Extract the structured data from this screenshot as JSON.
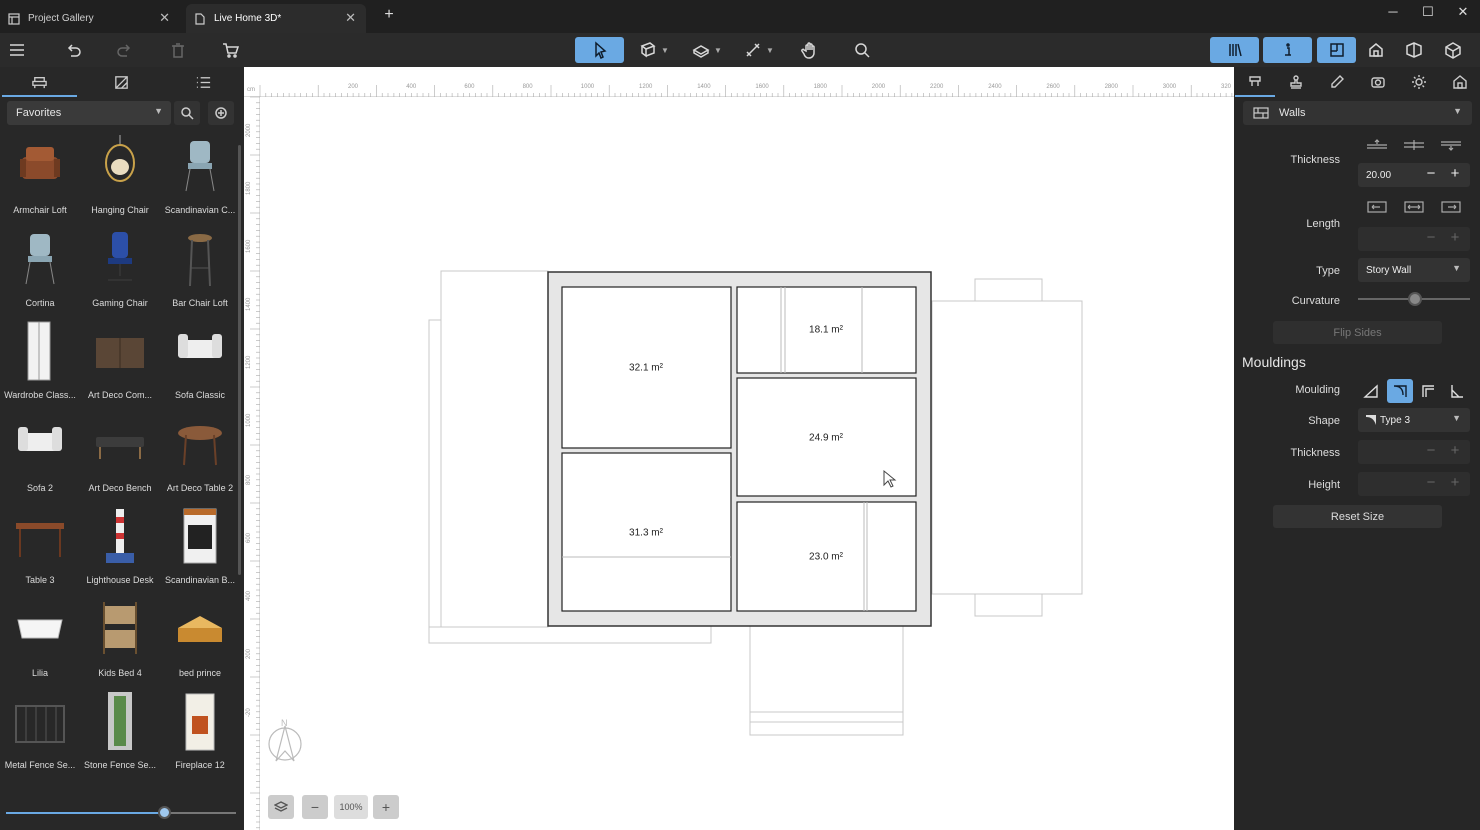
{
  "tabs": [
    {
      "label": "Project Gallery",
      "active": false
    },
    {
      "label": "Live Home 3D*",
      "active": true
    }
  ],
  "toolbar": {
    "icons": [
      "menu-icon",
      "undo-icon",
      "redo-icon",
      "delete-icon",
      "cart-icon",
      "select-arrow-icon",
      "build-tools-icon",
      "draw-tools-icon",
      "measure-icon",
      "pan-hand-icon",
      "search-icon"
    ],
    "right_icons": [
      "library-icon",
      "info-icon",
      "plan-2d-icon",
      "home-view-icon",
      "plan-3d-icon",
      "3d-view-icon"
    ]
  },
  "left_panel": {
    "tab_icons": [
      "furniture-icon",
      "materials-icon",
      "list-icon"
    ],
    "category": "Favorites",
    "items": [
      {
        "label": "Armchair Loft",
        "icon": "armchair-icon"
      },
      {
        "label": "Hanging Chair",
        "icon": "hanging-chair-icon"
      },
      {
        "label": "Scandinavian C...",
        "icon": "chair-icon"
      },
      {
        "label": "Cortina",
        "icon": "chair-icon"
      },
      {
        "label": "Gaming Chair",
        "icon": "gaming-chair-icon"
      },
      {
        "label": "Bar Chair Loft",
        "icon": "bar-stool-icon"
      },
      {
        "label": "Wardrobe Class...",
        "icon": "wardrobe-icon"
      },
      {
        "label": "Art Deco Com...",
        "icon": "commode-icon"
      },
      {
        "label": "Sofa Classic",
        "icon": "sofa-icon"
      },
      {
        "label": "Sofa 2",
        "icon": "sofa-icon"
      },
      {
        "label": "Art Deco Bench",
        "icon": "bench-icon"
      },
      {
        "label": "Art Deco Table 2",
        "icon": "table-icon"
      },
      {
        "label": "Table 3",
        "icon": "desk-icon"
      },
      {
        "label": "Lighthouse Desk",
        "icon": "lighthouse-icon"
      },
      {
        "label": "Scandinavian B...",
        "icon": "stove-icon"
      },
      {
        "label": "Lilia",
        "icon": "bathtub-icon"
      },
      {
        "label": "Kids Bed 4",
        "icon": "bunk-bed-icon"
      },
      {
        "label": "bed prince",
        "icon": "bed-icon"
      },
      {
        "label": "Metal Fence Se...",
        "icon": "fence-icon"
      },
      {
        "label": "Stone Fence Se...",
        "icon": "stone-fence-icon"
      },
      {
        "label": "Fireplace 12",
        "icon": "fireplace-icon"
      }
    ]
  },
  "canvas": {
    "ruler_unit": "cm",
    "top_ruler": [
      "200",
      "400",
      "600",
      "800",
      "1000",
      "1200",
      "1400",
      "1600",
      "1800",
      "2000",
      "2200",
      "2400",
      "2600",
      "2800",
      "3000",
      "320"
    ],
    "left_ruler": [
      "2000",
      "1800",
      "1600",
      "1400",
      "1200",
      "1000",
      "800",
      "600",
      "400",
      "200",
      "-20"
    ],
    "rooms": [
      "32.1 m²",
      "18.1 m²",
      "24.9 m²",
      "31.3 m²",
      "23.0 m²"
    ],
    "zoom": "100%"
  },
  "right_panel": {
    "tab_icons": [
      "object-properties-icon",
      "stamp-icon",
      "eyedropper-icon",
      "camera-icon",
      "sun-icon",
      "house-icon"
    ],
    "object_type": "Walls",
    "thickness_label": "Thickness",
    "thickness_value": "20.00",
    "length_label": "Length",
    "length_value": "",
    "type_label": "Type",
    "type_value": "Story Wall",
    "curvature_label": "Curvature",
    "curvature_value": 0.5,
    "flip_sides": "Flip Sides",
    "mouldings_title": "Mouldings",
    "moulding_label": "Moulding",
    "shape_label": "Shape",
    "shape_value": "Type 3",
    "m_thickness_label": "Thickness",
    "height_label": "Height",
    "reset_size": "Reset Size"
  },
  "colors": {
    "accent": "#6aa9e3",
    "panel": "#282828",
    "canvas": "#ffffff"
  }
}
